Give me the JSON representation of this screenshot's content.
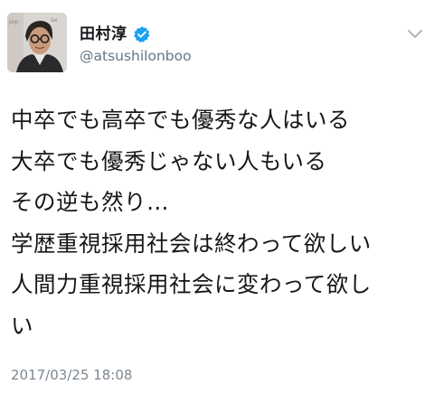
{
  "tweet": {
    "author": {
      "display_name": "田村淳",
      "handle": "@atsushilonboo",
      "avatar_icon": "avatar-photo",
      "verified_icon": "verified-badge-icon",
      "verified_color": "#1da1f2"
    },
    "menu_icon": "chevron-down-icon",
    "text_lines": [
      "中卒でも高卒でも優秀な人はいる",
      "大卒でも優秀じゃない人もいる",
      "その逆も然り…",
      "学歴重視採用社会は終わって欲しい",
      "人間力重視採用社会に変わって欲し",
      "い"
    ],
    "timestamp": "2017/03/25 18:08"
  }
}
